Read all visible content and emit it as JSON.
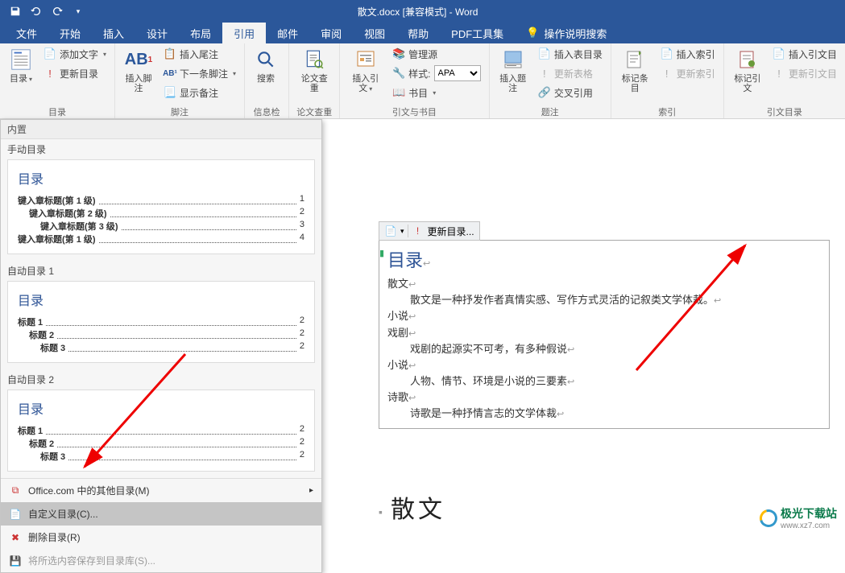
{
  "title": "散文.docx [兼容模式] - Word",
  "tabs": [
    "文件",
    "开始",
    "插入",
    "设计",
    "布局",
    "引用",
    "邮件",
    "审阅",
    "视图",
    "帮助",
    "PDF工具集"
  ],
  "tell_me": "操作说明搜索",
  "ribbon": {
    "toc_big": "目录",
    "add_text": "添加文字",
    "update_toc": "更新目录",
    "group_toc": "目录",
    "insert_footnote_big": "插入脚注",
    "ab_label": "AB",
    "insert_endnote": "插入尾注",
    "next_footnote": "下一条脚注",
    "show_notes": "显示备注",
    "group_footnote": "脚注",
    "search_big": "搜索",
    "group_info": "信息检索",
    "review_big": "论文查重",
    "group_review": "论文查重",
    "insert_citation_big": "插入引文",
    "manage_sources": "管理源",
    "style_label": "样式:",
    "style_value": "APA",
    "bibliography": "书目",
    "group_citation": "引文与书目",
    "insert_caption_big": "插入题注",
    "insert_table_figures": "插入表目录",
    "update_table": "更新表格",
    "cross_reference": "交叉引用",
    "group_caption": "题注",
    "mark_entry_big": "标记条目",
    "insert_index": "插入索引",
    "update_index": "更新索引",
    "group_index": "索引",
    "mark_citation_big": "标记引文",
    "insert_auth": "插入引文目",
    "update_auth": "更新引文目",
    "group_auth": "引文目录"
  },
  "gallery": {
    "header": "内置",
    "manual": "手动目录",
    "toc_heading": "目录",
    "manual_rows": [
      {
        "label": "键入章标题(第 1 级)",
        "page": "1",
        "indent": 0
      },
      {
        "label": "键入章标题(第 2 级)",
        "page": "2",
        "indent": 1
      },
      {
        "label": "键入章标题(第 3 级)",
        "page": "3",
        "indent": 2
      },
      {
        "label": "键入章标题(第 1 级)",
        "page": "4",
        "indent": 0
      }
    ],
    "auto1": "自动目录 1",
    "auto1_rows": [
      {
        "label": "标题 1",
        "page": "2",
        "indent": 0
      },
      {
        "label": "标题 2",
        "page": "2",
        "indent": 1
      },
      {
        "label": "标题 3",
        "page": "2",
        "indent": 2
      }
    ],
    "auto2": "自动目录 2",
    "auto2_rows": [
      {
        "label": "标题 1",
        "page": "2",
        "indent": 0
      },
      {
        "label": "标题 2",
        "page": "2",
        "indent": 1
      },
      {
        "label": "标题 3",
        "page": "2",
        "indent": 2
      }
    ],
    "office_more": "Office.com 中的其他目录(M)",
    "custom_toc": "自定义目录(C)...",
    "remove_toc": "删除目录(R)",
    "save_selection": "将所选内容保存到目录库(S)..."
  },
  "doc": {
    "update_btn": "更新目录...",
    "toc_title": "目录",
    "lines": [
      {
        "t": "散文",
        "i": 0
      },
      {
        "t": "散文是一种抒发作者真情实感、写作方式灵活的记叙类文学体裁。",
        "i": 1
      },
      {
        "t": "小说",
        "i": 0
      },
      {
        "t": "戏剧",
        "i": 0
      },
      {
        "t": "戏剧的起源实不可考，有多种假说",
        "i": 1
      },
      {
        "t": "小说",
        "i": 0
      },
      {
        "t": "人物、情节、环境是小说的三要素",
        "i": 1
      },
      {
        "t": "诗歌",
        "i": 0
      },
      {
        "t": "诗歌是一种抒情言志的文学体裁",
        "i": 1
      }
    ],
    "heading": "散文"
  },
  "watermark": {
    "brand": "极光下载站",
    "url": "www.xz7.com"
  }
}
